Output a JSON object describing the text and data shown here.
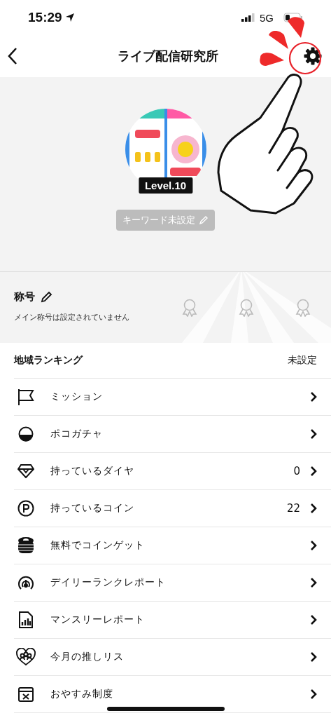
{
  "status_bar": {
    "time": "15:29",
    "network": "5G"
  },
  "nav": {
    "title": "ライブ配信研究所"
  },
  "profile": {
    "level": "Level.10",
    "keyword": "キーワード未設定"
  },
  "title_section": {
    "heading": "称号",
    "description": "メイン称号は設定されていません"
  },
  "region_ranking": {
    "label": "地域ランキング",
    "value": "未設定"
  },
  "menu": [
    {
      "kind": "flag",
      "label": "ミッション"
    },
    {
      "kind": "capsule",
      "label": "ポコガチャ"
    },
    {
      "kind": "diamond",
      "label": "持っているダイヤ",
      "value": "0"
    },
    {
      "kind": "coin",
      "label": "持っているコイン",
      "value": "22"
    },
    {
      "kind": "coin-stack",
      "label": "無料でコインゲット"
    },
    {
      "kind": "gauge",
      "label": "デイリーランクレポート"
    },
    {
      "kind": "chart",
      "label": "マンスリーレポート"
    },
    {
      "kind": "heart-group",
      "label": "今月の推しリス"
    },
    {
      "kind": "calendar-x",
      "label": "おやすみ制度"
    }
  ]
}
